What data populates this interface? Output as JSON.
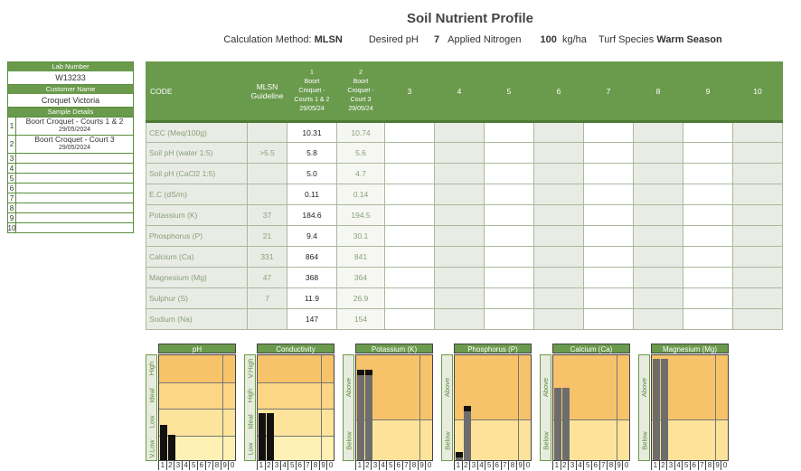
{
  "header": {
    "title": "Soil Nutrient Profile",
    "calc_label": "Calculation Method:",
    "calc_value": "MLSN",
    "ph_label": "Desired pH",
    "ph_value": "7",
    "n_label": "Applied Nitrogen",
    "n_value": "100",
    "n_unit": "kg/ha",
    "turf_label": "Turf Species",
    "turf_value": "Warm Season"
  },
  "left_panel": {
    "lab_number_label": "Lab Number",
    "lab_number": "W13233",
    "customer_label": "Customer Name",
    "customer": "Croquet Victoria",
    "sample_label": "Sample Details",
    "samples": [
      {
        "n": "1",
        "name": "Boort Croquet - Courts 1 & 2",
        "date": "29/05/2024"
      },
      {
        "n": "2",
        "name": "Boort Croquet - Court 3",
        "date": "29/05/2024"
      },
      {
        "n": "3",
        "name": "",
        "date": ""
      },
      {
        "n": "4",
        "name": "",
        "date": ""
      },
      {
        "n": "5",
        "name": "",
        "date": ""
      },
      {
        "n": "6",
        "name": "",
        "date": ""
      },
      {
        "n": "7",
        "name": "",
        "date": ""
      },
      {
        "n": "8",
        "name": "",
        "date": ""
      },
      {
        "n": "9",
        "name": "",
        "date": ""
      },
      {
        "n": "10",
        "name": "",
        "date": ""
      }
    ]
  },
  "table": {
    "code_label": "CODE",
    "guideline_label": "MLSN Guideline",
    "sample_cols": [
      {
        "num": "1",
        "l1": "Boort",
        "l2": "Croquet -",
        "l3": "Courts 1 & 2",
        "l4": "29/05/24"
      },
      {
        "num": "2",
        "l1": "Boort",
        "l2": "Croquet -",
        "l3": "Court 3",
        "l4": "29/05/24"
      }
    ],
    "empty_cols": [
      "3",
      "4",
      "5",
      "6",
      "7",
      "8",
      "9",
      "10"
    ],
    "rows": [
      {
        "code": "CEC (Meq/100g)",
        "guide": "",
        "s1": "10.31",
        "s2": "10.74"
      },
      {
        "code": "Soil pH (water 1:5)",
        "guide": ">5.5",
        "s1": "5.8",
        "s2": "5.6"
      },
      {
        "code": "Soil pH (CaCl2 1:5)",
        "guide": "",
        "s1": "5.0",
        "s2": "4.7"
      },
      {
        "code": "E.C (dS/m)",
        "guide": "",
        "s1": "0.11",
        "s2": "0.14"
      },
      {
        "code": "Potassium (K)",
        "guide": "37",
        "s1": "184.6",
        "s2": "194.5"
      },
      {
        "code": "Phosphorus (P)",
        "guide": "21",
        "s1": "9.4",
        "s2": "30.1"
      },
      {
        "code": "Calcium (Ca)",
        "guide": "331",
        "s1": "864",
        "s2": "841"
      },
      {
        "code": "Magnesium (Mg)",
        "guide": "47",
        "s1": "368",
        "s2": "364"
      },
      {
        "code": "Sulphur (S)",
        "guide": "7",
        "s1": "11.9",
        "s2": "26.9"
      },
      {
        "code": "Sodium (Na)",
        "guide": "",
        "s1": "147",
        "s2": "154"
      }
    ]
  },
  "chart_data": [
    {
      "type": "bar",
      "title": "pH",
      "bands": [
        "High",
        "Ideal",
        "Low",
        "V.Low"
      ],
      "categories": [
        "1",
        "2",
        "3",
        "4",
        "5",
        "6",
        "7",
        "8",
        "9",
        "0"
      ],
      "levels": [
        0.33,
        0.24
      ],
      "bar_color": "#111111",
      "grid": false
    },
    {
      "type": "bar",
      "title": "Conductivity",
      "bands": [
        "V.High",
        "High",
        "Ideal",
        "Low"
      ],
      "categories": [
        "1",
        "2",
        "3",
        "4",
        "5",
        "6",
        "7",
        "8",
        "9",
        "0"
      ],
      "levels": [
        0.44,
        0.44
      ],
      "bar_color": "#111111",
      "grid": false
    },
    {
      "type": "bar",
      "title": "Potassium (K)",
      "bands": [
        "Above",
        "Below"
      ],
      "categories": [
        "1",
        "2",
        "3",
        "4",
        "5",
        "6",
        "7",
        "8",
        "9",
        "0"
      ],
      "levels": [
        0.85,
        0.85
      ],
      "bar_color": "#6d6d6d",
      "cap": true,
      "grid": false
    },
    {
      "type": "bar",
      "title": "Phosphorus (P)",
      "bands": [
        "Above",
        "Below"
      ],
      "categories": [
        "1",
        "2",
        "3",
        "4",
        "5",
        "6",
        "7",
        "8",
        "9",
        "0"
      ],
      "levels": [
        0.08,
        0.51
      ],
      "bar_color": "#6d6d6d",
      "cap": true,
      "grid": false
    },
    {
      "type": "bar",
      "title": "Calcium (Ca)",
      "bands": [
        "Above",
        "Below"
      ],
      "categories": [
        "1",
        "2",
        "3",
        "4",
        "5",
        "6",
        "7",
        "8",
        "9",
        "0"
      ],
      "levels": [
        0.68,
        0.68
      ],
      "bar_color": "#6d6d6d",
      "grid": false
    },
    {
      "type": "bar",
      "title": "Magnesium (Mg)",
      "bands": [
        "Above",
        "Below"
      ],
      "categories": [
        "1",
        "2",
        "3",
        "4",
        "5",
        "6",
        "7",
        "8",
        "9",
        "0"
      ],
      "levels": [
        0.95,
        0.95
      ],
      "bar_color": "#6d6d6d",
      "grid": false
    }
  ]
}
